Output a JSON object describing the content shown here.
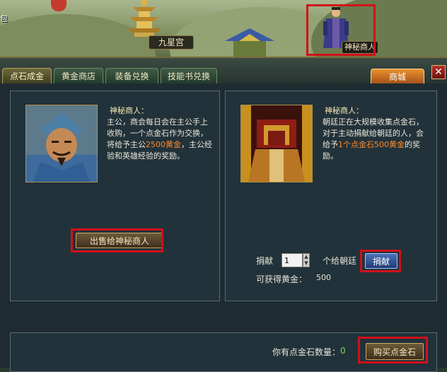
{
  "scene": {
    "bag_label": "包",
    "location_label": "九星宫",
    "npc_label": "神秘商人"
  },
  "tabs": {
    "items": [
      {
        "label": "点石成金"
      },
      {
        "label": "黄金商店"
      },
      {
        "label": "装备兑换"
      },
      {
        "label": "技能书兑换"
      }
    ],
    "mall_label": "商城",
    "close_glyph": "✕"
  },
  "sell_card": {
    "speaker": "神秘商人：",
    "text_before": "主公，商会每日会在主公手上收购，一个点金石作为交换，将给予主公",
    "highlight": "2500黄金",
    "text_after": "，主公经验和英雄经验的奖励。",
    "button_label": "出售给神秘商人"
  },
  "donate_card": {
    "speaker": "神秘商人：",
    "text_before": "朝廷正在大规模收集点金石，对于主动捐献给朝廷的人，会给予",
    "highlight": "1个点金石500黄金",
    "text_after": "的奖励。",
    "donate_label": "捐献",
    "quantity": "1",
    "unit_label": "个给朝廷",
    "donate_button": "捐献",
    "gain_label": "可获得黄金：",
    "gain_value": "500"
  },
  "footer": {
    "count_label": "你有点金石数量：",
    "count_value": "0",
    "buy_button": "购买点金石"
  },
  "colors": {
    "highlight": "#ff8a2a",
    "frame_red": "#d0101a",
    "mall_tab": "#e8922e",
    "count_green": "#7cd65a"
  }
}
